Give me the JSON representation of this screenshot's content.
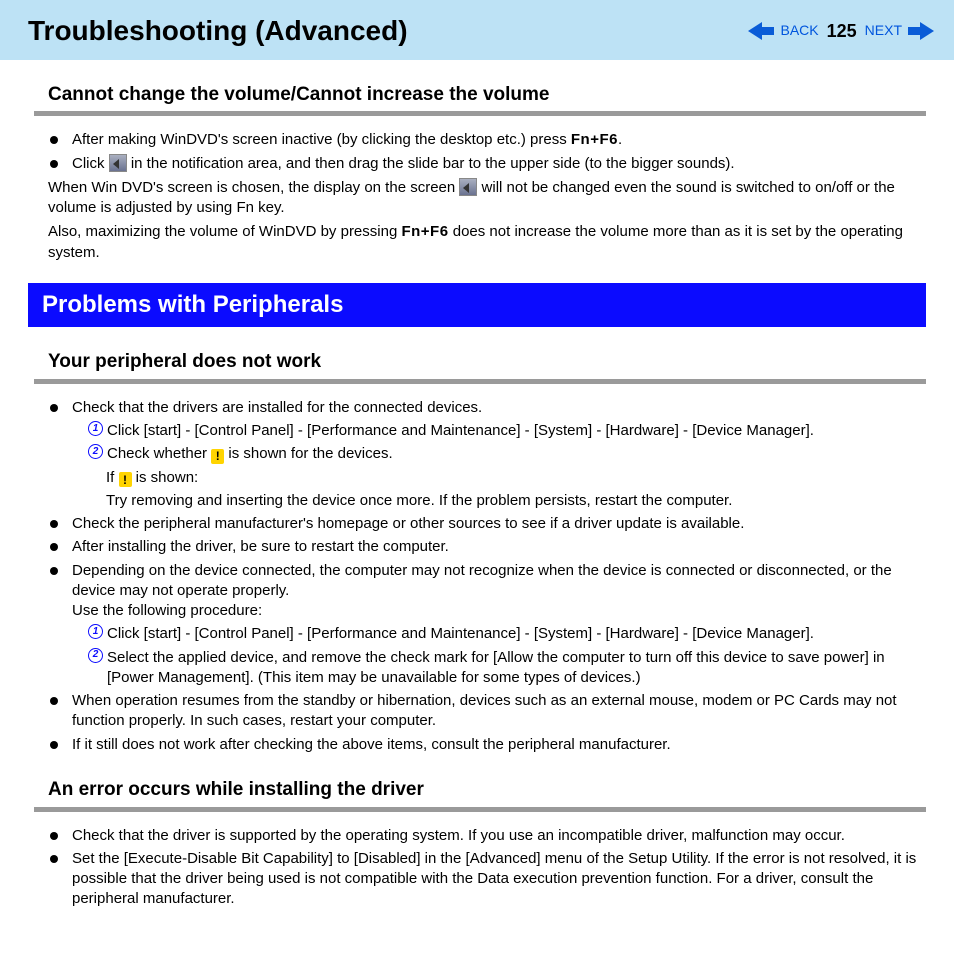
{
  "header": {
    "title": "Troubleshooting (Advanced)",
    "back": "BACK",
    "page": "125",
    "next": "NEXT"
  },
  "section1": {
    "title": "Cannot change the volume/Cannot increase the volume",
    "b1_pre": "After making WinDVD's screen inactive (by clicking the desktop etc.) press ",
    "b1_keys": "Fn+F6",
    "b1_post": ".",
    "b2_pre": "Click ",
    "b2_post": " in the notification area, and then drag the slide bar to the upper side (to the bigger sounds).",
    "p1_pre": "When Win DVD's screen is chosen, the display on the screen ",
    "p1_post": " will not be changed even the sound is switched to on/off or the volume is adjusted by using Fn key.",
    "p2_pre": "Also, maximizing the volume of WinDVD by pressing ",
    "p2_keys": "Fn+F6",
    "p2_post": " does not increase the volume more than as it is set by the operating system."
  },
  "banner": "Problems with Peripherals",
  "section2": {
    "title": "Your peripheral does not work",
    "b1": "Check that the drivers are installed for the connected devices.",
    "s1": "Click [start] - [Control Panel] - [Performance and Maintenance] - [System] - [Hardware] - [Device Manager].",
    "s2_pre": "Check whether ",
    "s2_post": " is shown for the devices.",
    "s2a_pre": "If ",
    "s2a_post": " is shown:",
    "s2b": "Try removing and inserting the device once more.  If the problem persists, restart the computer.",
    "b2": "Check the peripheral manufacturer's homepage or other sources to see if a driver update is available.",
    "b3": "After installing the driver, be sure to restart the computer.",
    "b4a": "Depending on the device connected, the computer may not recognize when the device is connected or disconnected, or the device may not operate properly.",
    "b4b": "Use the following procedure:",
    "s3": "Click [start] - [Control Panel] - [Performance and Maintenance] - [System] - [Hardware] - [Device Manager].",
    "s4": "Select the applied device, and remove the check mark for [Allow the computer to turn off this device to save power] in [Power Management]. (This item may be unavailable for some types of devices.)",
    "b5": "When operation resumes from the standby or hibernation, devices such as an external mouse, modem or PC Cards may not function properly. In such cases, restart your computer.",
    "b6": "If it still does not work after checking the above items, consult the peripheral manufacturer."
  },
  "section3": {
    "title": "An error occurs while installing the driver",
    "b1": "Check that the driver is supported by the operating system. If you use an incompatible driver, malfunction may occur.",
    "b2": "Set the [Execute-Disable Bit Capability] to [Disabled] in the [Advanced] menu of the Setup Utility. If the error is not resolved, it is possible that the driver being used is not compatible with the Data execution prevention function. For a driver, consult the peripheral manufacturer."
  }
}
